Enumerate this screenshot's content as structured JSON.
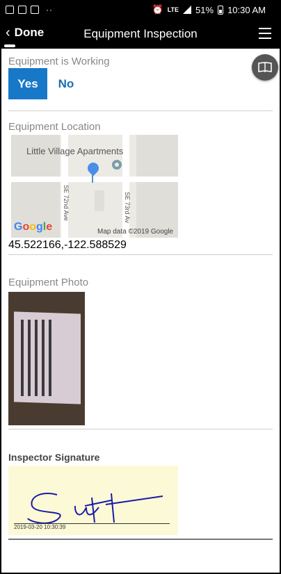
{
  "status_bar": {
    "network": "LTE",
    "battery": "51%",
    "time": "10:30 AM"
  },
  "header": {
    "back_label": "Done",
    "title": "Equipment Inspection"
  },
  "working": {
    "label": "Equipment is Working",
    "yes_label": "Yes",
    "no_label": "No",
    "selected": "Yes"
  },
  "location": {
    "label": "Equipment Location",
    "map_place": "Little Village Apartments",
    "street_1": "SE 72nd Ave",
    "street_2": "SE 73rd Av",
    "map_attribution": "Map data ©2019 Google",
    "coordinates": "45.522166,-122.588529"
  },
  "photo": {
    "label": "Equipment Photo"
  },
  "signature": {
    "label": "Inspector Signature",
    "timestamp": "2019-03-20 10:30:39"
  },
  "colors": {
    "accent": "#1878c8",
    "link": "#1a6eb5",
    "signature_bg": "#fcf9d6",
    "signature_ink": "#1a1aa8"
  }
}
